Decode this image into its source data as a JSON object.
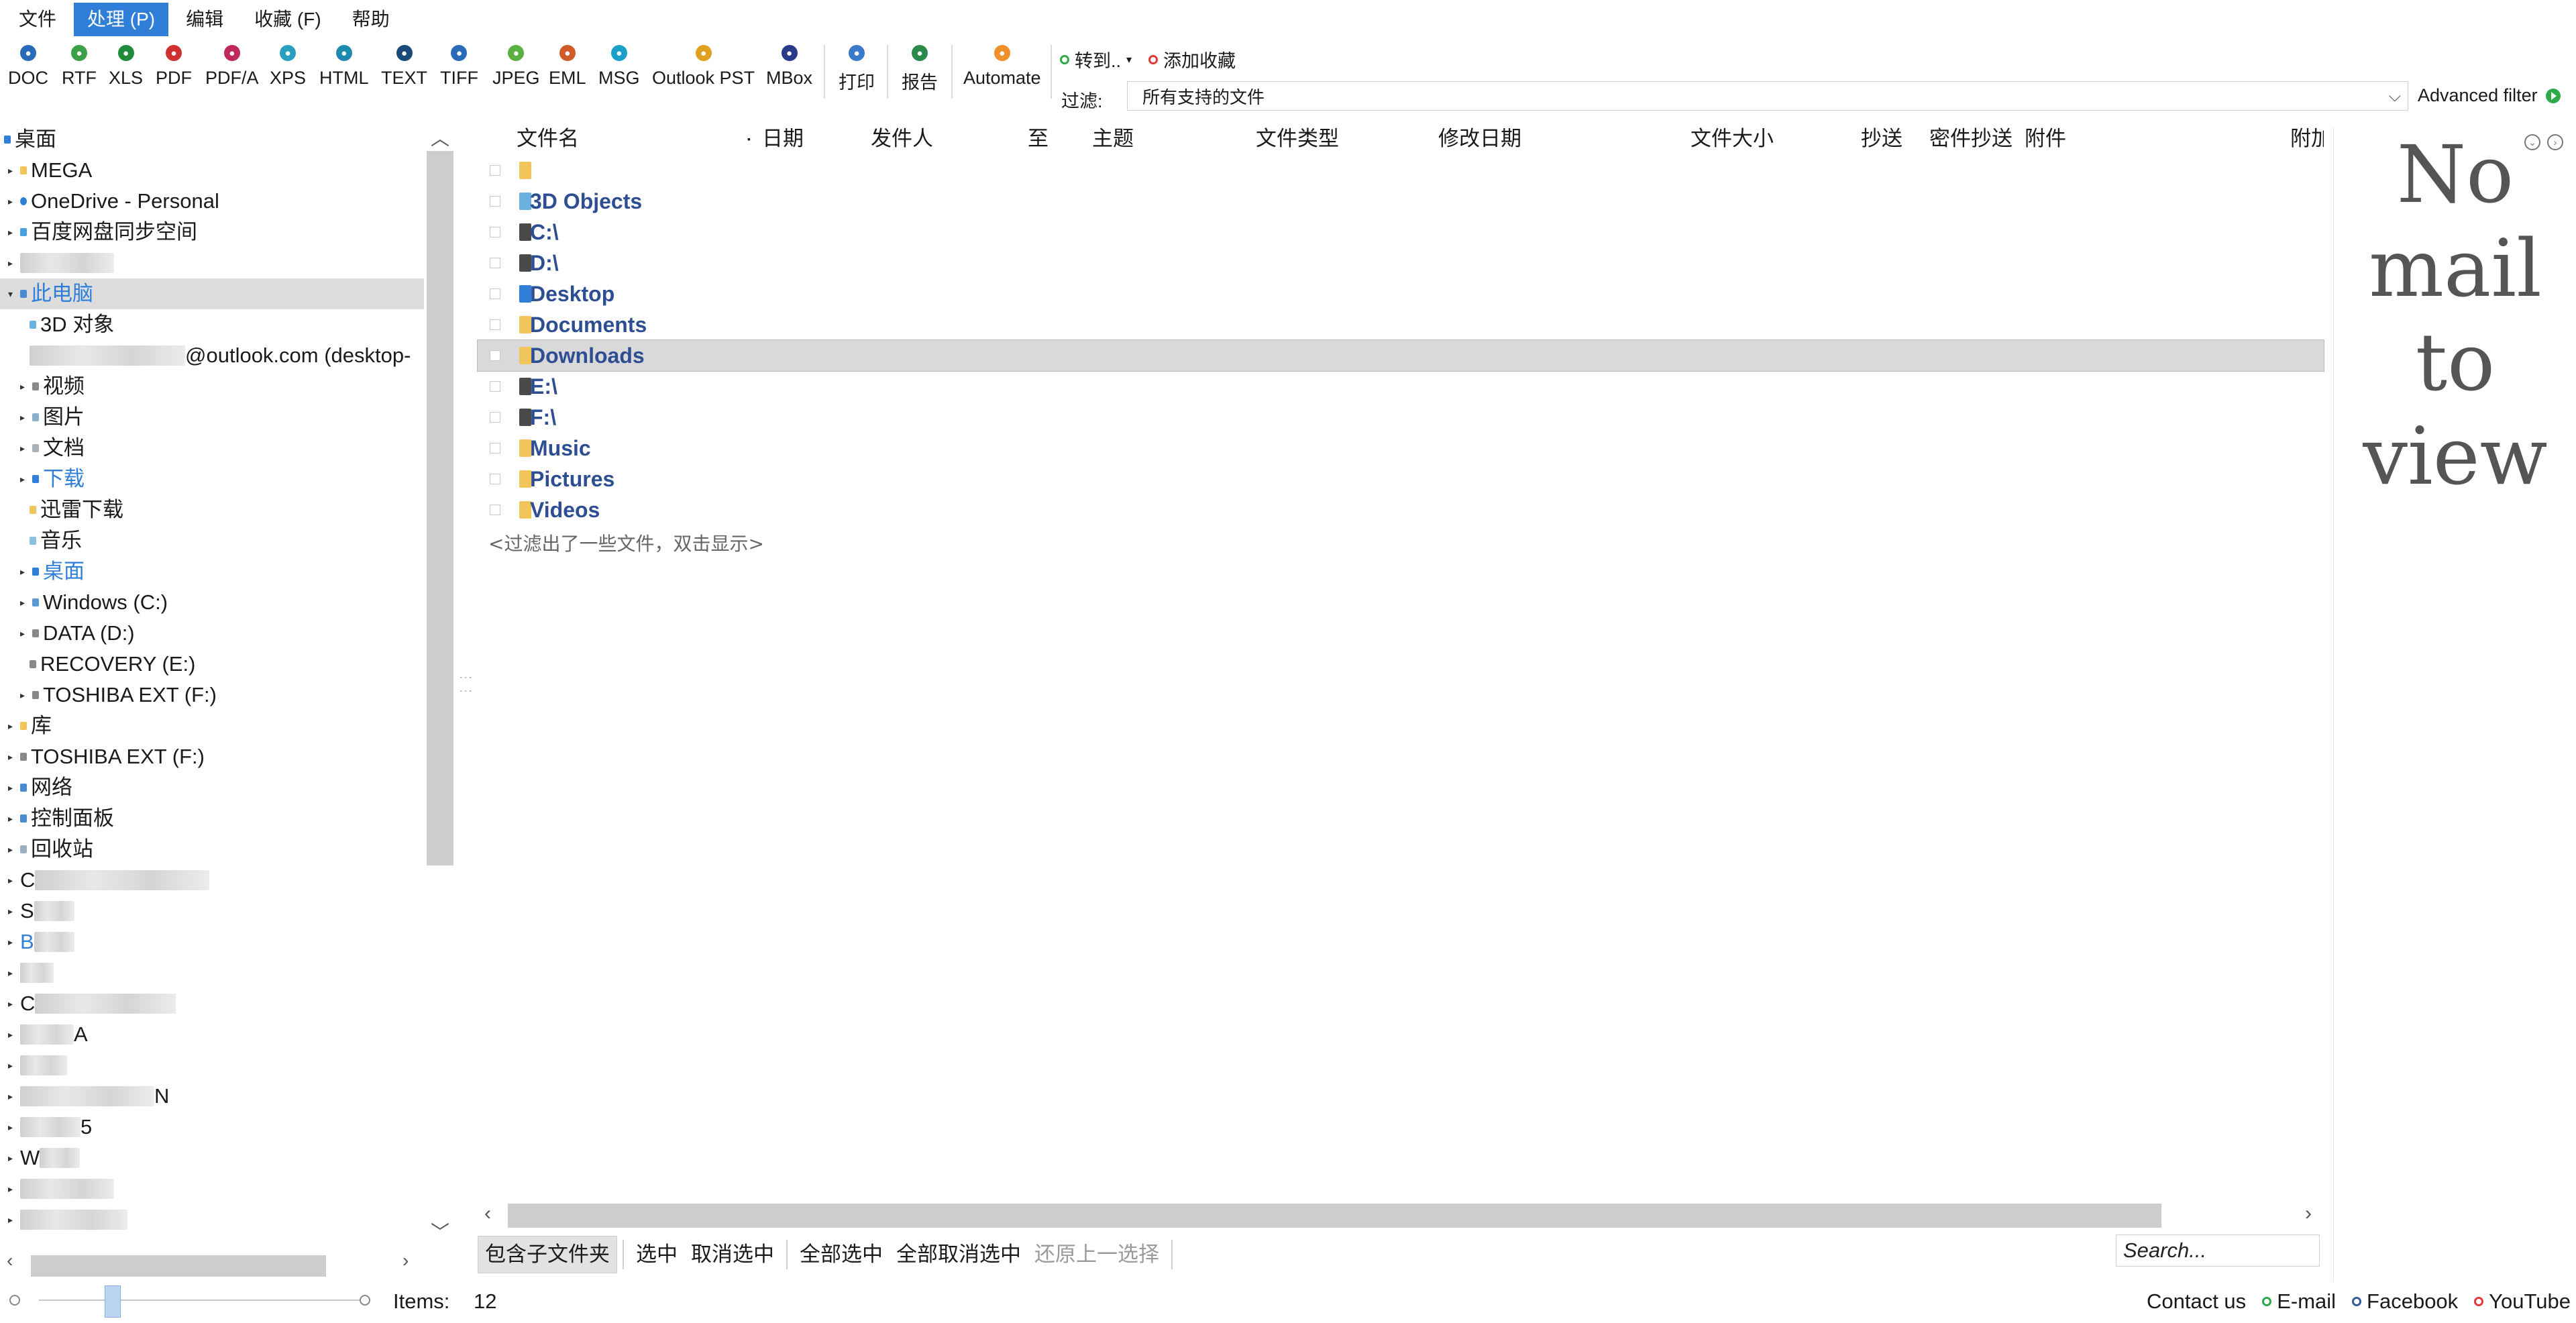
{
  "menu": [
    "文件",
    "处理 (P)",
    "编辑",
    "收藏 (F)",
    "帮助"
  ],
  "toolbar": {
    "formats": [
      {
        "label": "DOC",
        "color": "#2a6ab8"
      },
      {
        "label": "RTF",
        "color": "#3aa04a"
      },
      {
        "label": "XLS",
        "color": "#1f8a3a"
      },
      {
        "label": "PDF",
        "color": "#d03030"
      },
      {
        "label": "PDF/A",
        "color": "#c02a5a"
      },
      {
        "label": "XPS",
        "color": "#2aa0c0"
      },
      {
        "label": "HTML",
        "color": "#1f8ab0"
      },
      {
        "label": "TEXT",
        "color": "#1a4a7a"
      },
      {
        "label": "TIFF",
        "color": "#2a6ab8"
      },
      {
        "label": "JPEG",
        "color": "#5ab040"
      },
      {
        "label": "EML",
        "color": "#d05a2a"
      },
      {
        "label": "MSG",
        "color": "#1aa0c8"
      },
      {
        "label": "Outlook PST",
        "color": "#e0a020"
      },
      {
        "label": "MBox",
        "color": "#2a3a8a"
      }
    ],
    "print_label": "打印",
    "report_label": "报告",
    "automate_label": "Automate",
    "goto_label": "转到..",
    "add_fav_label": "添加收藏",
    "filter_label": "过滤:",
    "filter_value": "所有支持的文件",
    "advanced_filter_label": "Advanced filter"
  },
  "tree": {
    "root": "桌面",
    "items": [
      {
        "label": "MEGA"
      },
      {
        "label": "OneDrive - Personal"
      },
      {
        "label": "百度网盘同步空间"
      },
      {
        "label": "此电脑"
      },
      {
        "label": "3D 对象"
      },
      {
        "label": "@outlook.com (desktop-"
      },
      {
        "label": "视频"
      },
      {
        "label": "图片"
      },
      {
        "label": "文档"
      },
      {
        "label": "下载"
      },
      {
        "label": "迅雷下载"
      },
      {
        "label": "音乐"
      },
      {
        "label": "桌面"
      },
      {
        "label": "Windows (C:)"
      },
      {
        "label": "DATA (D:)"
      },
      {
        "label": "RECOVERY (E:)"
      },
      {
        "label": "TOSHIBA EXT (F:)"
      },
      {
        "label": "库"
      },
      {
        "label": "TOSHIBA EXT (F:)"
      },
      {
        "label": "网络"
      },
      {
        "label": "控制面板"
      },
      {
        "label": "回收站"
      },
      {
        "label": "C"
      },
      {
        "label": "S"
      },
      {
        "label": "B"
      },
      {
        "label": ""
      },
      {
        "label": "C"
      },
      {
        "label": "A"
      },
      {
        "label": ""
      },
      {
        "label": "N"
      },
      {
        "label": "5"
      },
      {
        "label": "W"
      },
      {
        "label": ""
      },
      {
        "label": ""
      }
    ]
  },
  "list": {
    "columns": [
      "文件名",
      "日期",
      "发件人",
      "至",
      "主题",
      "文件类型",
      "修改日期",
      "文件大小",
      "抄送",
      "密件抄送",
      "附件",
      "附加"
    ],
    "rows": [
      {
        "name": ""
      },
      {
        "name": "3D Objects"
      },
      {
        "name": "C:\\"
      },
      {
        "name": "D:\\"
      },
      {
        "name": "Desktop"
      },
      {
        "name": "Documents"
      },
      {
        "name": "Downloads"
      },
      {
        "name": "E:\\"
      },
      {
        "name": "F:\\"
      },
      {
        "name": "Music"
      },
      {
        "name": "Pictures"
      },
      {
        "name": "Videos"
      }
    ],
    "hidden_note": "<过滤出了一些文件，双击显示>"
  },
  "actions": {
    "include_subfolders": "包含子文件夹",
    "select": "选中",
    "deselect": "取消选中",
    "select_all": "全部选中",
    "deselect_all": "全部取消选中",
    "restore_selection": "还原上一选择",
    "search_placeholder": "Search..."
  },
  "preview": {
    "message": "No mail to view"
  },
  "status": {
    "items_label": "Items:",
    "items_count": "12",
    "contact": "Contact us",
    "email": "E-mail",
    "facebook": "Facebook",
    "youtube": "YouTube"
  }
}
